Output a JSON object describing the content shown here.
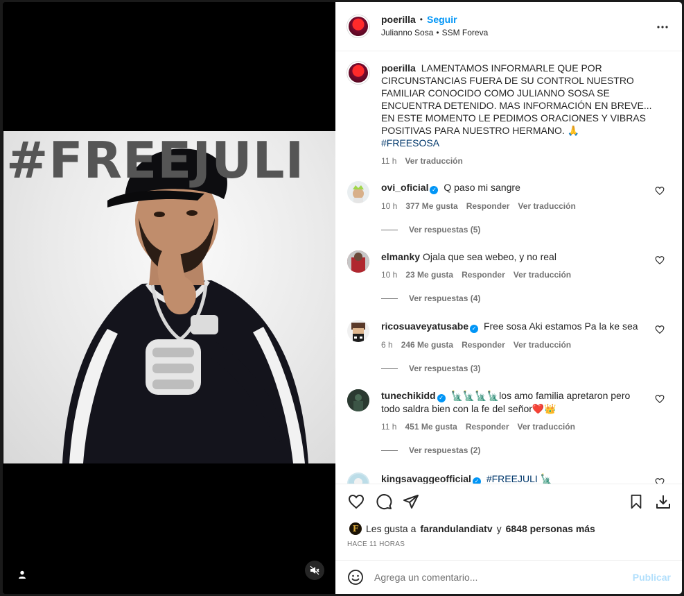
{
  "post": {
    "photo_hashtag": "#FREEJULI"
  },
  "header": {
    "username": "poerilla",
    "separator": "•",
    "follow_label": "Seguir",
    "subtitle_artist": "Julianno Sosa",
    "subtitle_sep": "•",
    "subtitle_song": "SSM Foreva",
    "more_icon": "more-options-icon"
  },
  "caption": {
    "username": "poerilla",
    "text": "LAMENTAMOS INFORMARLE QUE POR CIRCUNSTANCIAS FUERA DE SU CONTROL NUESTRO FAMILIAR CONOCIDO COMO JULIANNO SOSA SE ENCUENTRA DETENIDO. MAS INFORMACIÓN EN BREVE... EN ESTE MOMENTO LE PEDIMOS ORACIONES Y VIBRAS POSITIVAS PARA NUESTRO HERMANO. 🙏",
    "hashtag": "#FREESOSA",
    "time": "11 h",
    "translate": "Ver traducción"
  },
  "comments": [
    {
      "username": "ovi_oficial",
      "verified": true,
      "text": "Q paso mi sangre",
      "time": "10 h",
      "likes": "377 Me gusta",
      "reply": "Responder",
      "translate": "Ver traducción",
      "replies": "Ver respuestas (5)"
    },
    {
      "username": "elmanky",
      "verified": false,
      "text": "Ojala que sea webeo, y no real",
      "time": "10 h",
      "likes": "23 Me gusta",
      "reply": "Responder",
      "translate": "Ver traducción",
      "replies": "Ver respuestas (4)"
    },
    {
      "username": "ricosuaveyatusabe",
      "verified": true,
      "text": "Free sosa Aki estamos Pa la ke sea",
      "time": "6 h",
      "likes": "246 Me gusta",
      "reply": "Responder",
      "translate": "Ver traducción",
      "replies": "Ver respuestas (3)"
    },
    {
      "username": "tunechikidd",
      "verified": true,
      "text": "🗽🗽🗽🗽los amo familia apretaron pero todo saldra bien con la fe del señor❤️👑",
      "time": "11 h",
      "likes": "451 Me gusta",
      "reply": "Responder",
      "translate": "Ver traducción",
      "replies": "Ver respuestas (2)"
    },
    {
      "username": "kingsavaggeofficial",
      "verified": true,
      "text": "#FREEJULI 🗽"
    }
  ],
  "actions": {
    "likes_prefix": "Les gusta a",
    "likes_user": "farandulandiatv",
    "likes_and": "y",
    "likes_others": "6848 personas más",
    "timestamp": "HACE 11 HORAS",
    "mini_avatar_letter": "F"
  },
  "add_comment": {
    "placeholder": "Agrega un comentario...",
    "publish_label": "Publicar"
  },
  "colors": {
    "accent": "#0095f6",
    "publish_disabled": "#b2dffc",
    "secondary_text": "#737373",
    "hashtag": "#00376b"
  }
}
